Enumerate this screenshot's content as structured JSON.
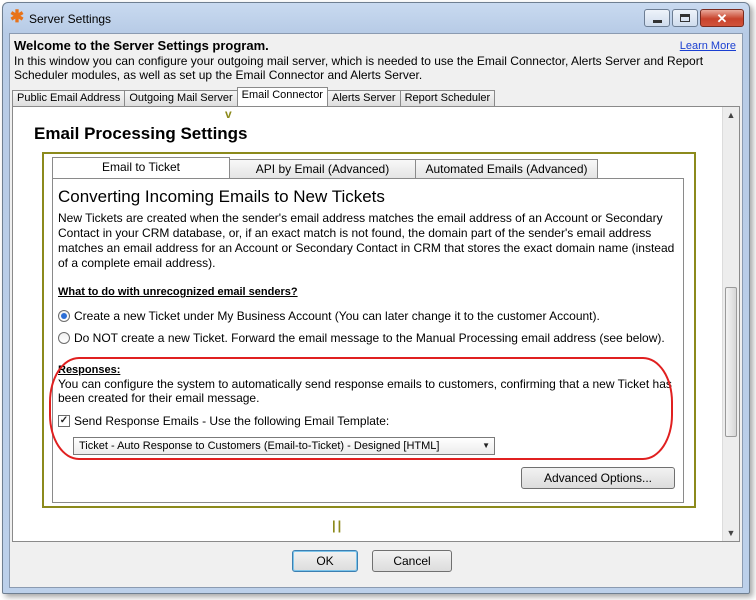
{
  "window": {
    "title": "Server Settings",
    "app_icon": "asterisk-icon",
    "controls": {
      "minimize": "minimize-icon",
      "maximize": "maximize-icon",
      "close": "close-icon",
      "close_glyph": "✕"
    }
  },
  "header": {
    "welcome": "Welcome to the Server Settings program.",
    "learn_more": "Learn More",
    "intro": "In this window you can configure your outgoing mail server, which is needed to use the Email Connector, Alerts Server and Report Scheduler modules, as well as set up the Email Connector and Alerts Server."
  },
  "outer_tabs": [
    {
      "label": "Public Email Address"
    },
    {
      "label": "Outgoing Mail Server"
    },
    {
      "label": "Email Connector",
      "active": true
    },
    {
      "label": "Alerts Server"
    },
    {
      "label": "Report Scheduler"
    }
  ],
  "panel": {
    "arrow_marker": "v",
    "section_title": "Email Processing Settings",
    "inner_tabs": [
      {
        "label": "Email to Ticket",
        "active": true
      },
      {
        "label": "API by Email (Advanced)"
      },
      {
        "label": "Automated Emails  (Advanced)"
      }
    ],
    "heading": "Converting Incoming Emails to New Tickets",
    "description": "New Tickets are created when the sender's email address matches the email address of an Account or Secondary Contact in your CRM database, or, if an exact match is not found, the domain  part of the sender's email address matches an email address for an Account or Secondary Contact in CRM that stores the exact domain name (instead of a complete email address).",
    "unrecognized_label": "What to do with unrecognized email senders?",
    "options": [
      {
        "label": "Create a new Ticket under My Business Account (You can later change it to the customer Account).",
        "selected": true
      },
      {
        "label": "Do NOT create a new Ticket. Forward the email message to the Manual Processing email address (see below).",
        "selected": false
      }
    ],
    "responses_label": "Responses:",
    "responses_desc": "You can configure the system to automatically send response emails to customers, confirming that a new Ticket has been created for their email message.",
    "send_checkbox": {
      "label": "Send Response Emails - Use the following Email Template:",
      "checked": true,
      "mark": "✓"
    },
    "template_value": "Ticket - Auto Response to Customers (Email-to-Ticket) - Designed [HTML]",
    "advanced_button": "Advanced Options...",
    "pause_marker": "||"
  },
  "footer": {
    "ok": "OK",
    "cancel": "Cancel"
  },
  "colors": {
    "highlight_red": "#e02020",
    "annotation_olive": "#8c8a1c",
    "link": "#1a3fd1"
  }
}
